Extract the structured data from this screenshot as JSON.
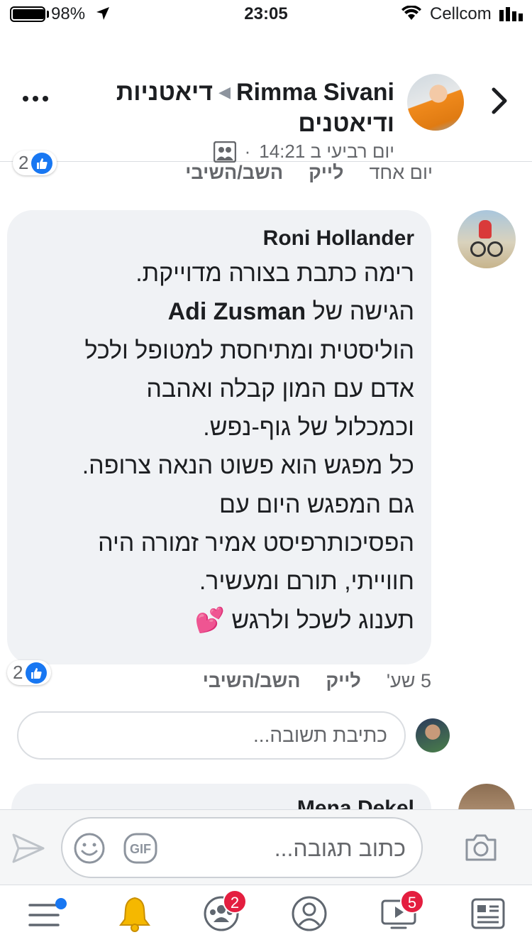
{
  "status_bar": {
    "battery_pct": "98%",
    "battery_level": 0.98,
    "time": "23:05",
    "carrier": "Cellcom"
  },
  "post_header": {
    "author": "Rimma Sivani",
    "group": "דיאטניות ודיאטנים",
    "timestamp": "יום רביעי ב 14:21",
    "icons": [
      "chevron-right-icon",
      "more-icon",
      "group-audience-icon"
    ]
  },
  "previous_comment": {
    "age": "יום אחד",
    "like_label": "לייק",
    "reply_label": "השב/השיבי",
    "reaction_count": "2"
  },
  "comment": {
    "author": "Roni Hollander",
    "text_line1": "רימה כתבת בצורה מדוייקת.",
    "text_line2_prefix": "הגישה של ",
    "text_line2_tag": "Adi Zusman",
    "text_line3": "הוליסטית ומתיחסת למטופל ולכל\nאדם עם המון קבלה ואהבה\nוכמכלול של גוף-נפש.\nכל מפגש הוא פשוט הנאה צרופה.\nגם המפגש היום עם\nהפסיכותרפיסט אמיר זמורה היה\nחווייתי, תורם ומעשיר.\nתענוג לשכל ולרגש 💕",
    "age": "5 שע'",
    "like_label": "לייק",
    "reply_label": "השב/השיבי",
    "reaction_count": "2"
  },
  "reply_input": {
    "placeholder": "כתיבת תשובה..."
  },
  "next_comment": {
    "author": "Mena Dekel"
  },
  "composer": {
    "placeholder": "כתוב תגובה...",
    "gif_label": "GIF"
  },
  "tab_bar": {
    "groups_badge": "2",
    "watch_badge": "5"
  },
  "colors": {
    "accent": "#1877f2",
    "badge_red": "#e41e3f",
    "bubble_bg": "#f0f2f5",
    "secondary_text": "#65676b"
  }
}
